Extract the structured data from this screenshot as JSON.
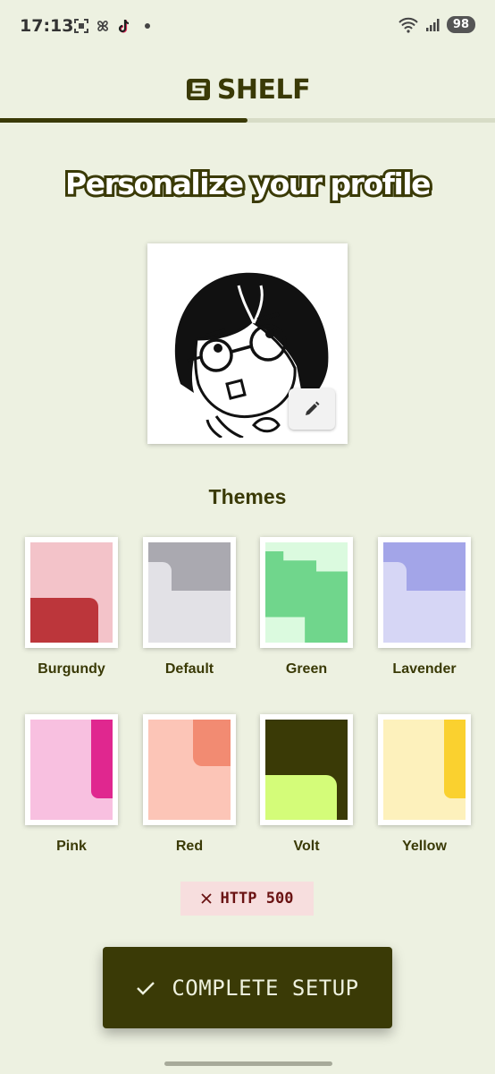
{
  "status_bar": {
    "time": "17:13",
    "battery": "98",
    "left_icons": [
      "screenshot-icon",
      "pinwheel-icon",
      "tiktok-icon",
      "notification-dot"
    ],
    "right_icons": [
      "wifi-icon",
      "signal-icon",
      "battery-icon"
    ]
  },
  "header": {
    "logo_text": "SHELF",
    "progress": 0.5
  },
  "main": {
    "title": "Personalize your profile",
    "avatar_edit_icon": "pencil-icon",
    "themes_title": "Themes",
    "themes": [
      {
        "label": "Burgundy",
        "colors": {
          "bg": "#f3c3c9",
          "accent": "#bc363b"
        }
      },
      {
        "label": "Default",
        "colors": {
          "bg": "#e2e1e6",
          "accent": "#aaa9b0"
        }
      },
      {
        "label": "Green",
        "colors": {
          "bg": "#dbfadf",
          "accent": "#70d68c"
        }
      },
      {
        "label": "Lavender",
        "colors": {
          "bg": "#d6d6f5",
          "accent": "#a3a5e8"
        }
      },
      {
        "label": "Pink",
        "colors": {
          "bg": "#f8c0e0",
          "accent": "#e0278f"
        }
      },
      {
        "label": "Red",
        "colors": {
          "bg": "#fcc5b7",
          "accent": "#f28b72"
        }
      },
      {
        "label": "Volt",
        "colors": {
          "bg": "#3a3a06",
          "accent": "#d4fc79"
        }
      },
      {
        "label": "Yellow",
        "colors": {
          "bg": "#fdf1bc",
          "accent": "#fad12f"
        }
      }
    ],
    "error": {
      "icon": "close-icon",
      "text": "HTTP 500"
    },
    "complete_button": {
      "icon": "check-icon",
      "label": "COMPLETE SETUP"
    }
  },
  "colors": {
    "background": "#edf1e1",
    "primary": "#3a3a06",
    "error_bg": "#f7dede",
    "error_text": "#6a1212"
  }
}
